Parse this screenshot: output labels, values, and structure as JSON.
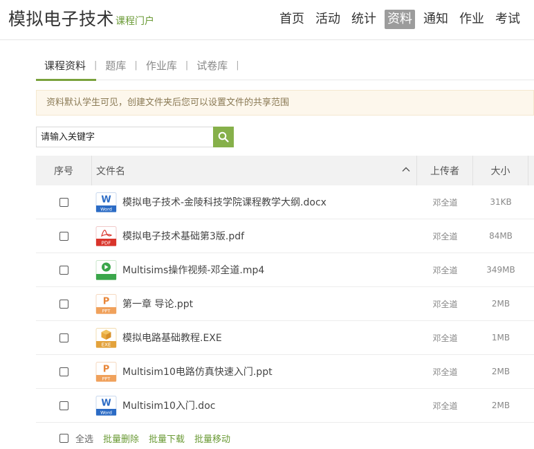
{
  "header": {
    "brand_title": "模拟电子技术",
    "brand_sub": "课程门户",
    "nav": [
      {
        "label": "首页",
        "active": false
      },
      {
        "label": "活动",
        "active": false
      },
      {
        "label": "统计",
        "active": false
      },
      {
        "label": "资料",
        "active": true
      },
      {
        "label": "通知",
        "active": false
      },
      {
        "label": "作业",
        "active": false
      },
      {
        "label": "考试",
        "active": false
      }
    ]
  },
  "subtabs": [
    "课程资料",
    "题库",
    "作业库",
    "试卷库"
  ],
  "subtab_separator": "|",
  "notice": "资料默认学生可见，创建文件夹后您可以设置文件的共享范围",
  "search": {
    "placeholder": "请输入关键字"
  },
  "table": {
    "headers": {
      "seq": "序号",
      "name": "文件名",
      "uploader": "上传者",
      "size": "大小"
    },
    "rows": [
      {
        "type": "word",
        "name": "模拟电子技术-金陵科技学院课程教学大纲.docx",
        "uploader": "邓全道",
        "size": "31KB"
      },
      {
        "type": "pdf",
        "name": "模拟电子技术基础第3版.pdf",
        "uploader": "邓全道",
        "size": "84MB"
      },
      {
        "type": "video",
        "name": "Multisims操作视频-邓全道.mp4",
        "uploader": "邓全道",
        "size": "349MB"
      },
      {
        "type": "ppt",
        "name": "第一章 导论.ppt",
        "uploader": "邓全道",
        "size": "2MB"
      },
      {
        "type": "exe",
        "name": "模拟电路基础教程.EXE",
        "uploader": "邓全道",
        "size": "1MB"
      },
      {
        "type": "ppt",
        "name": "Multisim10电路仿真快速入门.ppt",
        "uploader": "邓全道",
        "size": "2MB"
      },
      {
        "type": "word",
        "name": "Multisim10入门.doc",
        "uploader": "邓全道",
        "size": "2MB"
      }
    ]
  },
  "icon_labels": {
    "word": "W",
    "word_sub": "Word",
    "pdf": "PDF",
    "ppt": "P",
    "ppt_sub": "PPT",
    "exe": "EXE"
  },
  "footer": {
    "select_all": "全选",
    "actions": [
      "批量删除",
      "批量下载",
      "批量移动"
    ]
  },
  "colors": {
    "accent": "#7aa23c",
    "nav_active_bg": "#9c9c9c",
    "notice_bg": "#fdf7ec"
  }
}
